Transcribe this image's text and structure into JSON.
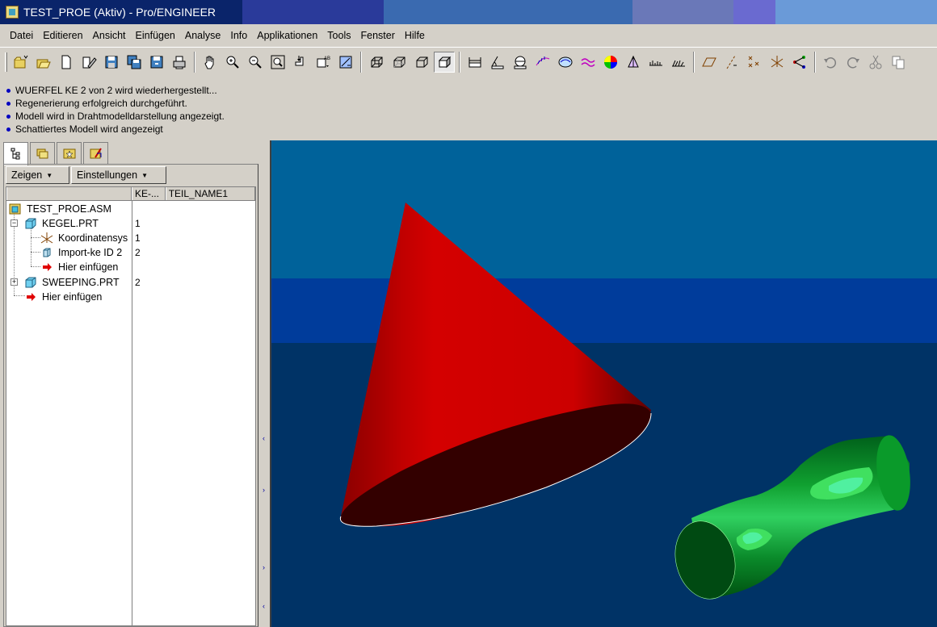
{
  "window": {
    "title": "TEST_PROE (Aktiv) - Pro/ENGINEER"
  },
  "menu": [
    "Datei",
    "Editieren",
    "Ansicht",
    "Einfügen",
    "Analyse",
    "Info",
    "Applikationen",
    "Tools",
    "Fenster",
    "Hilfe"
  ],
  "toolbar": {
    "icons": [
      "new-folder-icon",
      "open-icon",
      "new-file-icon",
      "edit-icon",
      "save-icon",
      "save-copy-icon",
      "backup-icon",
      "print-icon",
      "pan-icon",
      "zoom-in-icon",
      "zoom-out-icon",
      "refit-icon",
      "reorient-icon",
      "named-views-icon",
      "spin-center-icon",
      "wireframe-icon",
      "hidden-line-icon",
      "no-hidden-icon",
      "shaded-icon",
      "measure-distance-icon",
      "measure-angle-icon",
      "measure-diameter-icon",
      "curvature-icon",
      "shade-curvature-icon",
      "deviation-icon",
      "slope-icon",
      "reflection-icon",
      "section-icon",
      "draft-icon",
      "datum-plane-icon",
      "datum-axis-icon",
      "datum-point-icon",
      "coordinate-system-icon",
      "model-tree-icon",
      "undo-icon",
      "redo-icon",
      "cut-icon",
      "copy-icon"
    ],
    "pressed": "shaded-icon"
  },
  "messages": [
    "WUERFEL KE 2 von 2 wird wiederhergestellt...",
    "Regenerierung erfolgreich durchgeführt.",
    "Modell wird in Drahtmodelldarstellung angezeigt.",
    "Schattiertes Modell wird angezeigt"
  ],
  "panel": {
    "buttons": {
      "show": "Zeigen",
      "settings": "Einstellungen"
    },
    "columns": [
      "",
      "KE-...",
      "TEIL_NAME1"
    ],
    "tree": [
      {
        "label": "TEST_PROE.ASM",
        "ke": "",
        "level": 0,
        "icon": "assembly-icon"
      },
      {
        "label": "KEGEL.PRT",
        "ke": "1",
        "level": 1,
        "icon": "part-icon",
        "expanded": true
      },
      {
        "label": "Koordinatensys",
        "ke": "1",
        "level": 2,
        "icon": "coordinate-system-icon"
      },
      {
        "label": "Import-ke ID 2",
        "ke": "2",
        "level": 2,
        "icon": "import-feature-icon"
      },
      {
        "label": "Hier einfügen",
        "ke": "",
        "level": 2,
        "icon": "insert-here-icon"
      },
      {
        "label": "SWEEPING.PRT",
        "ke": "2",
        "level": 1,
        "icon": "part-icon",
        "expanded": false
      },
      {
        "label": "Hier einfügen",
        "ke": "",
        "level": 1,
        "icon": "insert-here-icon"
      }
    ]
  },
  "colors": {
    "viewport_top": "#00629a",
    "viewport_band": "#003c9b",
    "viewport_bottom": "#003366",
    "cone": "#cc0000",
    "cone_base": "#330000",
    "sweep": "#0a8a2a"
  }
}
